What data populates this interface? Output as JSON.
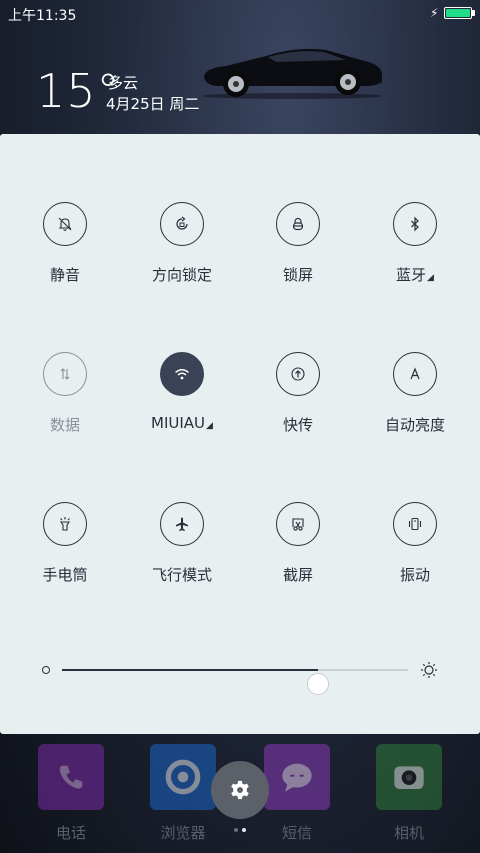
{
  "status_bar": {
    "time": "上午11:35"
  },
  "weather": {
    "temperature": "15°",
    "condition": "多云",
    "date": "4月25日 周二"
  },
  "tiles": [
    {
      "label": "静音",
      "icon": "bell-off-icon",
      "state": "off"
    },
    {
      "label": "方向锁定",
      "icon": "rotation-lock-icon",
      "state": "off"
    },
    {
      "label": "锁屏",
      "icon": "lock-icon",
      "state": "off"
    },
    {
      "label": "蓝牙",
      "icon": "bluetooth-icon",
      "state": "off",
      "expandable": true
    },
    {
      "label": "数据",
      "icon": "mobile-data-icon",
      "state": "disabled"
    },
    {
      "label": "MIUIAU",
      "icon": "wifi-icon",
      "state": "on",
      "expandable": true
    },
    {
      "label": "快传",
      "icon": "quick-transfer-icon",
      "state": "off"
    },
    {
      "label": "自动亮度",
      "icon": "auto-brightness-icon",
      "state": "off"
    },
    {
      "label": "手电筒",
      "icon": "flashlight-icon",
      "state": "off"
    },
    {
      "label": "飞行模式",
      "icon": "airplane-icon",
      "state": "off"
    },
    {
      "label": "截屏",
      "icon": "screenshot-icon",
      "state": "off"
    },
    {
      "label": "振动",
      "icon": "vibrate-icon",
      "state": "off"
    }
  ],
  "brightness": {
    "level": 0.74
  },
  "dock": {
    "apps": [
      {
        "label": "电话",
        "icon": "phone-icon",
        "color": "#7a2aa8"
      },
      {
        "label": "浏览器",
        "icon": "browser-icon",
        "color": "#1a66c8"
      },
      {
        "label": "短信",
        "icon": "message-icon",
        "color": "#8a3ab8"
      },
      {
        "label": "相机",
        "icon": "camera-icon",
        "color": "#2f7a3a"
      }
    ]
  },
  "colors": {
    "panel_bg": "#e8eff1",
    "active_tile": "#3a4255",
    "battery": "#22dd88",
    "text_dark": "#2a2f3a",
    "text_disabled": "#8a9099"
  }
}
